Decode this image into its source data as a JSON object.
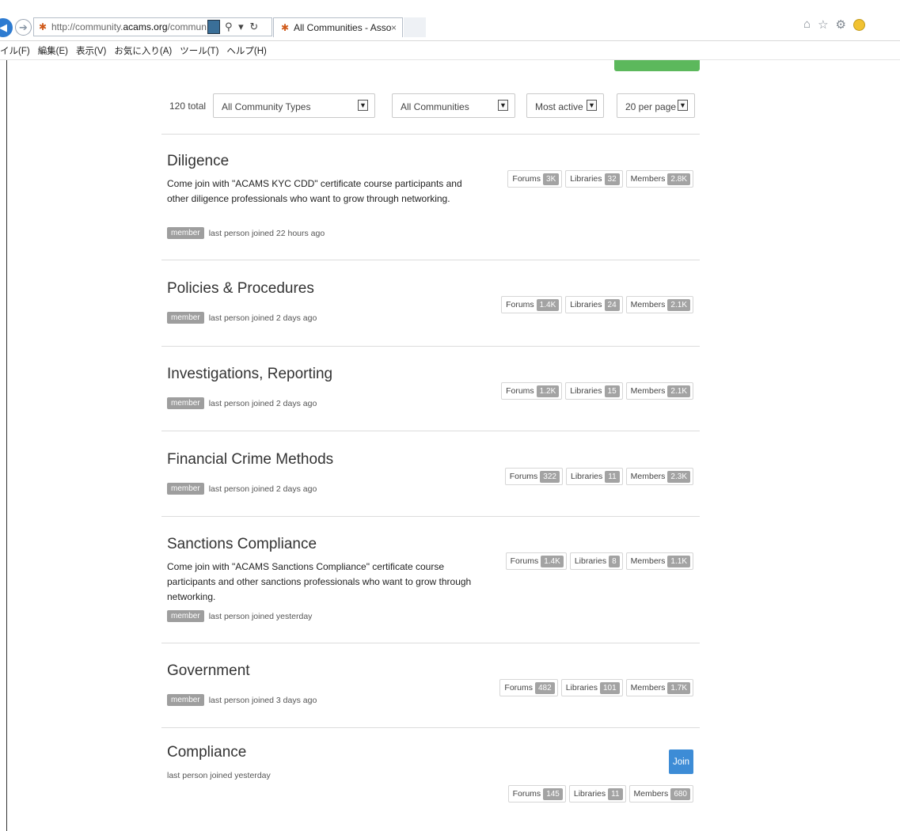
{
  "browser": {
    "url_prefix": "http://community.",
    "url_domain": "acams.org",
    "url_path": "/communities/allcommunities?Disp",
    "tab_title": "All Communities - Associati...",
    "tab_close": "×",
    "menu": [
      "イル(F)",
      "編集(E)",
      "表示(V)",
      "お気に入り(A)",
      "ツール(T)",
      "ヘルプ(H)"
    ]
  },
  "filters": {
    "total": "120 total",
    "community_types": "All Community Types",
    "communities": "All Communities",
    "sort": "Most active",
    "per_page": "20 per page"
  },
  "labels": {
    "member": "member",
    "forums": "Forums",
    "libraries": "Libraries",
    "members": "Members",
    "join": "Join"
  },
  "communities": [
    {
      "title": "Diligence",
      "desc": "Come join with \"ACAMS KYC CDD\" certificate course participants and other diligence professionals who want to grow through networking.",
      "joined": "last person joined 22 hours ago",
      "forums": "3K",
      "libraries": "32",
      "members": "2.8K"
    },
    {
      "title": "Policies & Procedures",
      "joined": "last person joined 2 days ago",
      "forums": "1.4K",
      "libraries": "24",
      "members": "2.1K"
    },
    {
      "title": "Investigations, Reporting",
      "joined": "last person joined 2 days ago",
      "forums": "1.2K",
      "libraries": "15",
      "members": "2.1K"
    },
    {
      "title": "Financial Crime Methods",
      "joined": "last person joined 2 days ago",
      "forums": "322",
      "libraries": "11",
      "members": "2.3K"
    },
    {
      "title": "Sanctions Compliance",
      "desc": "Come join with \"ACAMS Sanctions Compliance\" certificate course participants and other sanctions professionals who want to grow through networking.",
      "joined": "last person joined yesterday",
      "forums": "1.4K",
      "libraries": "8",
      "members": "1.1K"
    },
    {
      "title": "Government",
      "joined": "last person joined 3 days ago",
      "forums": "482",
      "libraries": "101",
      "members": "1.7K"
    },
    {
      "title": "Compliance",
      "joined": "last person joined yesterday",
      "forums": "145",
      "libraries": "11",
      "members": "680"
    }
  ]
}
